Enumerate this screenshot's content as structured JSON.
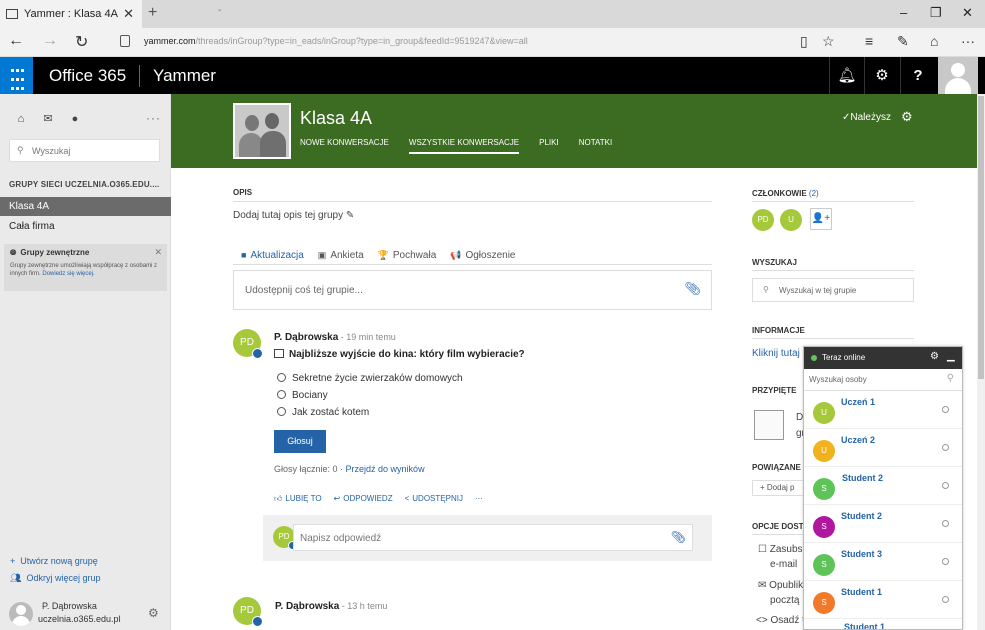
{
  "browser": {
    "tab_title": "Yammer : Klasa 4A",
    "tab_close": "✕",
    "new_tab": "+",
    "tab_extra": "-",
    "win_min": "–",
    "win_restore": "❐",
    "win_close": "✕",
    "url_host": "yammer.com",
    "url_path": "/threads/inGroup?type=in_eads/inGroup?type=in_group&feedId=9519247&view=all"
  },
  "topbar": {
    "suite": "Office 365",
    "app": "Yammer",
    "icons": [
      "bell-icon",
      "gear-icon",
      "help-icon",
      "avatar"
    ]
  },
  "sidebar": {
    "search_placeholder": "Wyszukaj",
    "groups_heading": "GRUPY SIECI UCZELNIA.O365.EDU....",
    "groups": [
      {
        "label": "Klasa 4A",
        "active": true
      },
      {
        "label": "Cała firma",
        "active": false
      }
    ],
    "external": {
      "title": "Grupy zewnętrzne",
      "desc": "Grupy zewnętrzne umożliwiają współpracę z osobami z innych firm.",
      "link": "Dowiedz się więcej."
    },
    "create_group": "Utwórz nową grupę",
    "discover_groups": "Odkryj więcej grup",
    "user_name": "P. Dąbrowska",
    "user_domain": "uczelnia.o365.edu.pl"
  },
  "group": {
    "title": "Klasa 4A",
    "tabs": [
      {
        "label": "NOWE KONWERSACJE",
        "active": false
      },
      {
        "label": "WSZYSTKIE KONWERSACJE",
        "active": true
      },
      {
        "label": "PLIKI",
        "active": false
      },
      {
        "label": "NOTATKI",
        "active": false
      }
    ],
    "membership": "✓Należysz",
    "color": "#3c6b22"
  },
  "main": {
    "opis_heading": "OPIS",
    "opis_text": "Dodaj tutaj opis tej grupy ✎",
    "publisher_tabs": [
      {
        "label": "Aktualizacja",
        "icon": "■",
        "active": true
      },
      {
        "label": "Ankieta",
        "icon": "▣",
        "active": false
      },
      {
        "label": "Pochwała",
        "icon": "🏆",
        "active": false
      },
      {
        "label": "Ogłoszenie",
        "icon": "📢",
        "active": false
      }
    ],
    "composer_placeholder": "Udostępnij coś tej grupie...",
    "post1": {
      "avatar": "PD",
      "author": "P. Dąbrowska",
      "time": " - 19 min temu",
      "question": "Najbliższe wyjście do kina: który film wybieracie?",
      "options": [
        "Sekretne życie zwierzaków domowych",
        "Bociany",
        "Jak zostać kotem"
      ],
      "vote_label": "Głosuj",
      "votes_total": "Głosy łącznie: 0",
      "votes_sep": " · ",
      "results_link": "Przejdź do wyników",
      "actions": [
        "LUBIĘ TO",
        "ODPOWIEDZ",
        "UDOSTĘPNIJ",
        "···"
      ],
      "reply_placeholder": "Napisz odpowiedź"
    },
    "post2": {
      "avatar": "PD",
      "author": "P. Dąbrowska",
      "time": " - 13 h temu"
    }
  },
  "right": {
    "members_heading": "CZŁONKOWIE",
    "members_count": "(2)",
    "members": [
      "PD",
      "U"
    ],
    "search_heading": "WYSZUKAJ",
    "search_placeholder": "Wyszukaj w tej grupie",
    "info_heading": "INFORMACJE",
    "info_link": "Kliknij tutaj",
    "pinned_heading": "PRZYPIĘTE",
    "pinned_a": "D",
    "pinned_b": "gr",
    "related_heading": "POWIĄZANE",
    "related_add": "+ Dodaj p",
    "options_heading": "OPCJE DOST",
    "opt1a": "Zasubsk",
    "opt1b": "e-mail",
    "opt2a": "Opublik",
    "opt2b": "pocztą",
    "opt3": "Osadź t"
  },
  "online": {
    "title": "Teraz online",
    "search_placeholder": "Wyszukaj osoby",
    "people": [
      {
        "name": "Uczeń 1",
        "initial": "U",
        "color": "#a5c93a"
      },
      {
        "name": "Uczeń 2",
        "initial": "U",
        "color": "#f0b31d"
      },
      {
        "name": "Student 2",
        "initial": "S",
        "color": "#5ec45a"
      },
      {
        "name": "Student 2",
        "initial": "S",
        "color": "#b0179e"
      },
      {
        "name": "Student 3",
        "initial": "S",
        "color": "#5ec45a"
      },
      {
        "name": "Student 1",
        "initial": "S",
        "color": "#f07a2a"
      },
      {
        "name": "Student 1",
        "initial": "S",
        "color": "#a5c93a"
      }
    ]
  }
}
